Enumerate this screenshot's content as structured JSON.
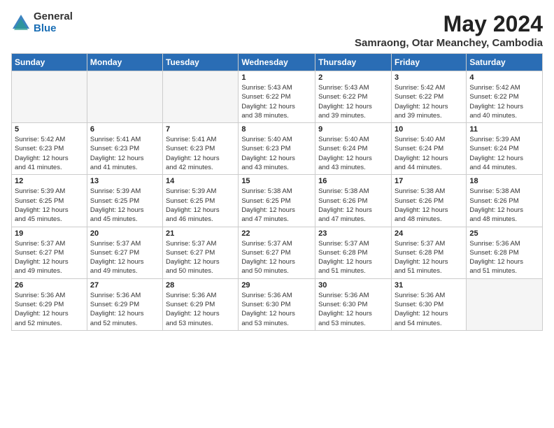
{
  "header": {
    "logo_general": "General",
    "logo_blue": "Blue",
    "month_year": "May 2024",
    "location": "Samraong, Otar Meanchey, Cambodia"
  },
  "days_of_week": [
    "Sunday",
    "Monday",
    "Tuesday",
    "Wednesday",
    "Thursday",
    "Friday",
    "Saturday"
  ],
  "weeks": [
    [
      {
        "day": "",
        "detail": ""
      },
      {
        "day": "",
        "detail": ""
      },
      {
        "day": "",
        "detail": ""
      },
      {
        "day": "1",
        "detail": "Sunrise: 5:43 AM\nSunset: 6:22 PM\nDaylight: 12 hours\nand 38 minutes."
      },
      {
        "day": "2",
        "detail": "Sunrise: 5:43 AM\nSunset: 6:22 PM\nDaylight: 12 hours\nand 39 minutes."
      },
      {
        "day": "3",
        "detail": "Sunrise: 5:42 AM\nSunset: 6:22 PM\nDaylight: 12 hours\nand 39 minutes."
      },
      {
        "day": "4",
        "detail": "Sunrise: 5:42 AM\nSunset: 6:22 PM\nDaylight: 12 hours\nand 40 minutes."
      }
    ],
    [
      {
        "day": "5",
        "detail": "Sunrise: 5:42 AM\nSunset: 6:23 PM\nDaylight: 12 hours\nand 41 minutes."
      },
      {
        "day": "6",
        "detail": "Sunrise: 5:41 AM\nSunset: 6:23 PM\nDaylight: 12 hours\nand 41 minutes."
      },
      {
        "day": "7",
        "detail": "Sunrise: 5:41 AM\nSunset: 6:23 PM\nDaylight: 12 hours\nand 42 minutes."
      },
      {
        "day": "8",
        "detail": "Sunrise: 5:40 AM\nSunset: 6:23 PM\nDaylight: 12 hours\nand 43 minutes."
      },
      {
        "day": "9",
        "detail": "Sunrise: 5:40 AM\nSunset: 6:24 PM\nDaylight: 12 hours\nand 43 minutes."
      },
      {
        "day": "10",
        "detail": "Sunrise: 5:40 AM\nSunset: 6:24 PM\nDaylight: 12 hours\nand 44 minutes."
      },
      {
        "day": "11",
        "detail": "Sunrise: 5:39 AM\nSunset: 6:24 PM\nDaylight: 12 hours\nand 44 minutes."
      }
    ],
    [
      {
        "day": "12",
        "detail": "Sunrise: 5:39 AM\nSunset: 6:25 PM\nDaylight: 12 hours\nand 45 minutes."
      },
      {
        "day": "13",
        "detail": "Sunrise: 5:39 AM\nSunset: 6:25 PM\nDaylight: 12 hours\nand 45 minutes."
      },
      {
        "day": "14",
        "detail": "Sunrise: 5:39 AM\nSunset: 6:25 PM\nDaylight: 12 hours\nand 46 minutes."
      },
      {
        "day": "15",
        "detail": "Sunrise: 5:38 AM\nSunset: 6:25 PM\nDaylight: 12 hours\nand 47 minutes."
      },
      {
        "day": "16",
        "detail": "Sunrise: 5:38 AM\nSunset: 6:26 PM\nDaylight: 12 hours\nand 47 minutes."
      },
      {
        "day": "17",
        "detail": "Sunrise: 5:38 AM\nSunset: 6:26 PM\nDaylight: 12 hours\nand 48 minutes."
      },
      {
        "day": "18",
        "detail": "Sunrise: 5:38 AM\nSunset: 6:26 PM\nDaylight: 12 hours\nand 48 minutes."
      }
    ],
    [
      {
        "day": "19",
        "detail": "Sunrise: 5:37 AM\nSunset: 6:27 PM\nDaylight: 12 hours\nand 49 minutes."
      },
      {
        "day": "20",
        "detail": "Sunrise: 5:37 AM\nSunset: 6:27 PM\nDaylight: 12 hours\nand 49 minutes."
      },
      {
        "day": "21",
        "detail": "Sunrise: 5:37 AM\nSunset: 6:27 PM\nDaylight: 12 hours\nand 50 minutes."
      },
      {
        "day": "22",
        "detail": "Sunrise: 5:37 AM\nSunset: 6:27 PM\nDaylight: 12 hours\nand 50 minutes."
      },
      {
        "day": "23",
        "detail": "Sunrise: 5:37 AM\nSunset: 6:28 PM\nDaylight: 12 hours\nand 51 minutes."
      },
      {
        "day": "24",
        "detail": "Sunrise: 5:37 AM\nSunset: 6:28 PM\nDaylight: 12 hours\nand 51 minutes."
      },
      {
        "day": "25",
        "detail": "Sunrise: 5:36 AM\nSunset: 6:28 PM\nDaylight: 12 hours\nand 51 minutes."
      }
    ],
    [
      {
        "day": "26",
        "detail": "Sunrise: 5:36 AM\nSunset: 6:29 PM\nDaylight: 12 hours\nand 52 minutes."
      },
      {
        "day": "27",
        "detail": "Sunrise: 5:36 AM\nSunset: 6:29 PM\nDaylight: 12 hours\nand 52 minutes."
      },
      {
        "day": "28",
        "detail": "Sunrise: 5:36 AM\nSunset: 6:29 PM\nDaylight: 12 hours\nand 53 minutes."
      },
      {
        "day": "29",
        "detail": "Sunrise: 5:36 AM\nSunset: 6:30 PM\nDaylight: 12 hours\nand 53 minutes."
      },
      {
        "day": "30",
        "detail": "Sunrise: 5:36 AM\nSunset: 6:30 PM\nDaylight: 12 hours\nand 53 minutes."
      },
      {
        "day": "31",
        "detail": "Sunrise: 5:36 AM\nSunset: 6:30 PM\nDaylight: 12 hours\nand 54 minutes."
      },
      {
        "day": "",
        "detail": ""
      }
    ]
  ]
}
